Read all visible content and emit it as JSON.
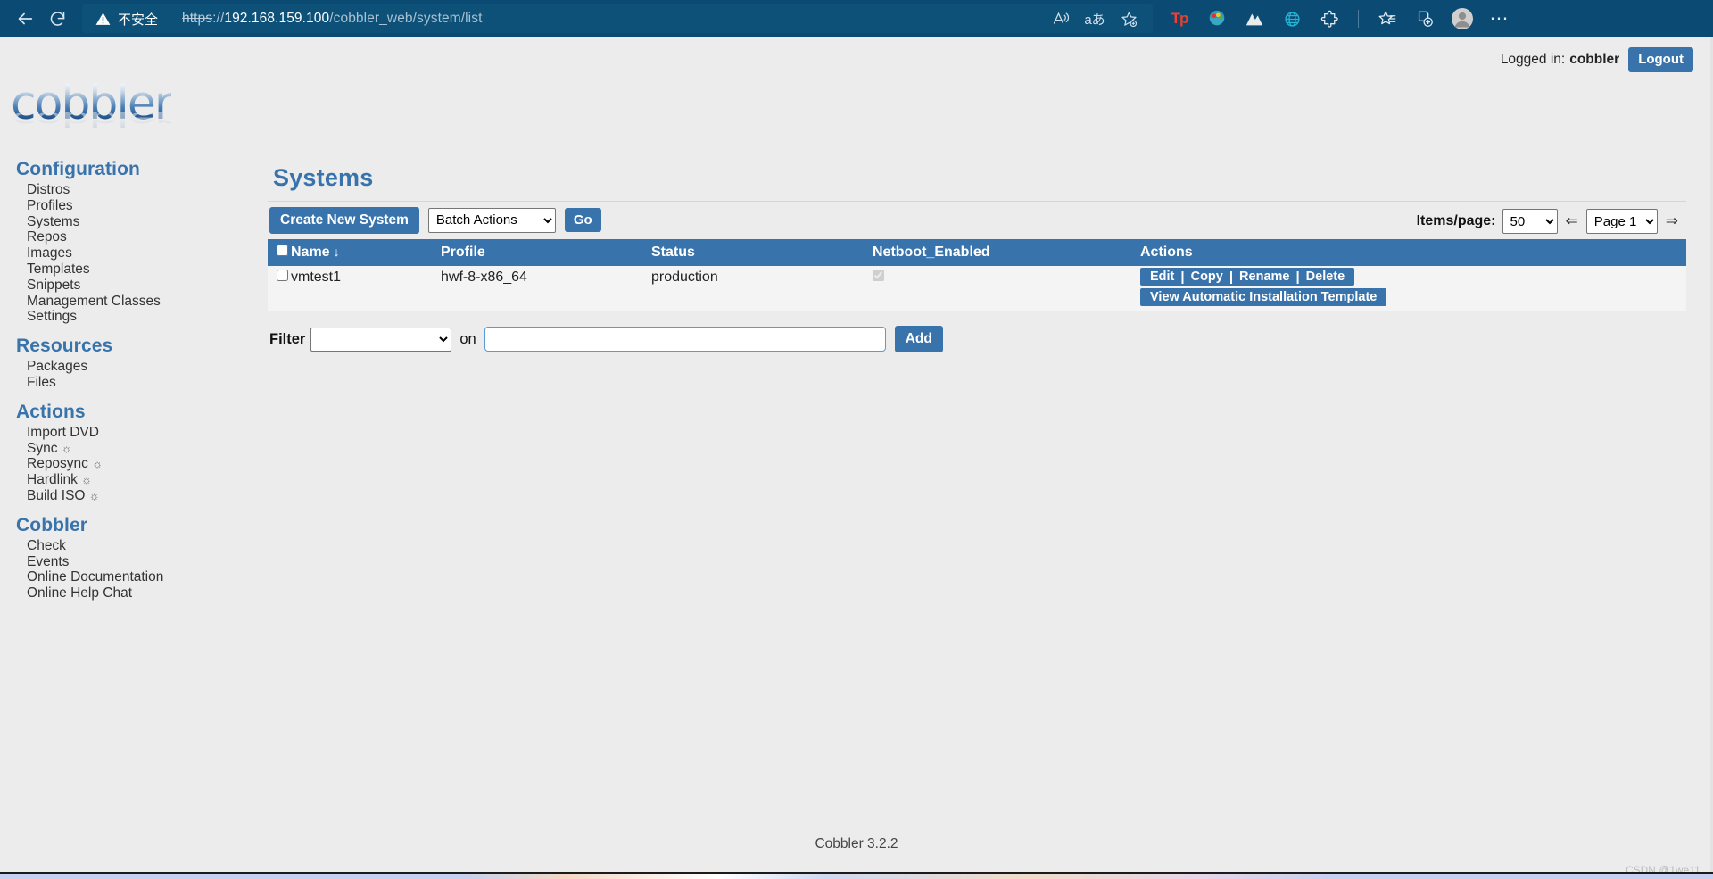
{
  "browser": {
    "back_icon": "back-arrow-icon",
    "reload_icon": "reload-icon",
    "security_label": "不安全",
    "url_scheme": "https",
    "url_sep": "://",
    "url_host": "192.168.159.100",
    "url_path": "/cobbler_web/system/list",
    "right_icons": [
      {
        "name": "read-aloud-icon",
        "glyph": "A"
      },
      {
        "name": "translate-icon",
        "glyph": "aあ"
      },
      {
        "name": "add-favorite-icon",
        "glyph": "☆"
      }
    ],
    "toolbar_icons": [
      {
        "name": "tp-extension-icon",
        "glyph": "Tp"
      },
      {
        "name": "color-palette-extension-icon",
        "glyph": "◕"
      },
      {
        "name": "mountain-extension-icon",
        "glyph": "▲"
      },
      {
        "name": "globe-extension-icon",
        "glyph": "🌐"
      },
      {
        "name": "puzzle-extensions-icon",
        "glyph": "🧩"
      },
      {
        "name": "favorites-icon",
        "glyph": "☆"
      },
      {
        "name": "collections-icon",
        "glyph": "⊞"
      },
      {
        "name": "profile-avatar-icon",
        "glyph": "●"
      },
      {
        "name": "settings-more-icon",
        "glyph": "⋯"
      }
    ],
    "colors": {
      "chrome_bg": "#0b4a72",
      "url_bg": "#0d5179"
    }
  },
  "header": {
    "logged_in_label": "Logged in:",
    "username": "cobbler",
    "logout_label": "Logout"
  },
  "logo": {
    "text": "cobbler"
  },
  "sidebar": {
    "sections": [
      {
        "heading": "Configuration",
        "items": [
          {
            "label": "Distros"
          },
          {
            "label": "Profiles"
          },
          {
            "label": "Systems"
          },
          {
            "label": "Repos"
          },
          {
            "label": "Images"
          },
          {
            "label": "Templates"
          },
          {
            "label": "Snippets"
          },
          {
            "label": "Management Classes"
          },
          {
            "label": "Settings"
          }
        ]
      },
      {
        "heading": "Resources",
        "items": [
          {
            "label": "Packages"
          },
          {
            "label": "Files"
          }
        ]
      },
      {
        "heading": "Actions",
        "items": [
          {
            "label": "Import DVD"
          },
          {
            "label": "Sync",
            "gear": "☼"
          },
          {
            "label": "Reposync",
            "gear": "☼"
          },
          {
            "label": "Hardlink",
            "gear": "☼"
          },
          {
            "label": "Build ISO",
            "gear": "☼"
          }
        ]
      },
      {
        "heading": "Cobbler",
        "items": [
          {
            "label": "Check"
          },
          {
            "label": "Events"
          },
          {
            "label": "Online Documentation"
          },
          {
            "label": "Online Help Chat"
          }
        ]
      }
    ]
  },
  "main": {
    "title": "Systems",
    "toolbar": {
      "create_label": "Create New System",
      "batch_actions_selected": "Batch Actions",
      "batch_actions_options": [
        "Batch Actions"
      ],
      "go_label": "Go"
    },
    "pager": {
      "items_per_page_label": "Items/page:",
      "items_per_page_value": "50",
      "items_per_page_options": [
        "50"
      ],
      "prev_arrow": "⇐",
      "page_value": "Page 1",
      "page_options": [
        "Page 1"
      ],
      "next_arrow": "⇒"
    },
    "table": {
      "columns": [
        "",
        "Name",
        "Profile",
        "Status",
        "Netboot_Enabled",
        "Actions"
      ],
      "sort_column": "Name",
      "sort_arrow": "↓",
      "rows": [
        {
          "selected": false,
          "name": "vmtest1",
          "profile": "hwf-8-x86_64",
          "status": "production",
          "netboot_enabled": true,
          "actions": [
            "Edit",
            "Copy",
            "Rename",
            "Delete"
          ],
          "secondary_action": "View Automatic Installation Template"
        }
      ],
      "action_separator": "|"
    },
    "filter": {
      "label": "Filter",
      "field_value": "",
      "field_options": [
        ""
      ],
      "on_label": "on",
      "value": "",
      "add_label": "Add"
    }
  },
  "footer": {
    "text": "Cobbler 3.2.2",
    "watermark": "CSDN @1we11"
  }
}
